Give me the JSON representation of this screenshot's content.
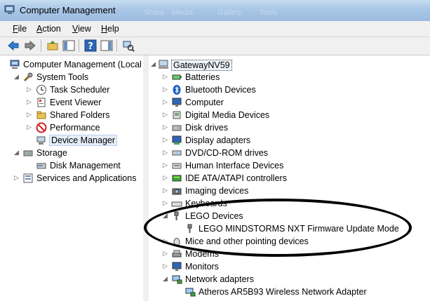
{
  "window": {
    "title": "Computer Management",
    "ghost_tabs": [
      "Share",
      "Media",
      "Gallery",
      "Tools"
    ]
  },
  "menu": [
    {
      "label_pre": "",
      "accel": "F",
      "label_post": "ile"
    },
    {
      "label_pre": "",
      "accel": "A",
      "label_post": "ction"
    },
    {
      "label_pre": "",
      "accel": "V",
      "label_post": "iew"
    },
    {
      "label_pre": "",
      "accel": "H",
      "label_post": "elp"
    }
  ],
  "left_tree": {
    "root": "Computer Management (Local",
    "system_tools": "System Tools",
    "task_scheduler": "Task Scheduler",
    "event_viewer": "Event Viewer",
    "shared_folders": "Shared Folders",
    "performance": "Performance",
    "device_manager": "Device Manager",
    "storage": "Storage",
    "disk_management": "Disk Management",
    "services_apps": "Services and Applications"
  },
  "right_tree": {
    "host": "GatewayNV59",
    "items": [
      "Batteries",
      "Bluetooth Devices",
      "Computer",
      "Digital Media Devices",
      "Disk drives",
      "Display adapters",
      "DVD/CD-ROM drives",
      "Human Interface Devices",
      "IDE ATA/ATAPI controllers",
      "Imaging devices",
      "Keyboards",
      "LEGO Devices",
      "LEGO MINDSTORMS NXT Firmware Update Mode",
      "Mice and other pointing devices",
      "Modems",
      "Monitors",
      "Network adapters",
      "Atheros AR5B93 Wireless Network Adapter"
    ]
  }
}
